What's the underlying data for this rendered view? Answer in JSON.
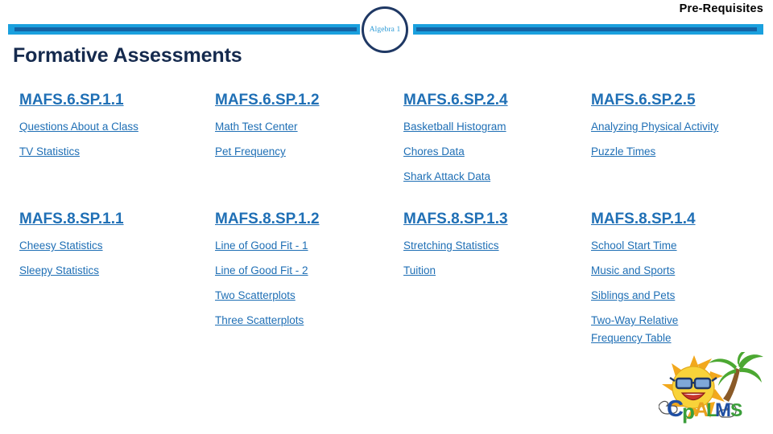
{
  "header": {
    "prerequisites_label": "Pre-Requisites",
    "node_label": "Algebra 1",
    "bar_color": "#1AA0DE",
    "bar_inner_color": "#1464A5",
    "node_border_color": "#1F3864",
    "node_text_color": "#2E9BD6"
  },
  "page": {
    "title": "Formative Assessments",
    "title_color": "#152A4E",
    "link_color": "#1F6FB5"
  },
  "rows": [
    {
      "columns": [
        {
          "standard": "MAFS.6.SP.1.1",
          "resources": [
            "Questions About a Class",
            "TV Statistics"
          ]
        },
        {
          "standard": "MAFS.6.SP.1.2",
          "resources": [
            "Math Test Center",
            "Pet Frequency"
          ]
        },
        {
          "standard": "MAFS.6.SP.2.4",
          "resources": [
            "Basketball Histogram",
            "Chores Data",
            "Shark Attack Data"
          ]
        },
        {
          "standard": "MAFS.6.SP.2.5",
          "resources": [
            "Analyzing Physical Activity",
            "Puzzle Times"
          ]
        }
      ]
    },
    {
      "columns": [
        {
          "standard": "MAFS.8.SP.1.1",
          "resources": [
            "Cheesy Statistics",
            "Sleepy Statistics"
          ]
        },
        {
          "standard": "MAFS.8.SP.1.2",
          "resources": [
            "Line of Good Fit - 1",
            "Line of Good Fit - 2",
            "Two Scatterplots",
            "Three Scatterplots"
          ]
        },
        {
          "standard": "MAFS.8.SP.1.3",
          "resources": [
            "Stretching Statistics",
            "Tuition"
          ]
        },
        {
          "standard": "MAFS.8.SP.1.4",
          "resources": [
            "School Start Time",
            "Music and Sports",
            "Siblings and Pets",
            "Two-Way Relative Frequency Table"
          ]
        }
      ]
    }
  ],
  "logo": {
    "name": "cpalms-logo",
    "text": "CPALMS",
    "letter_colors": [
      "#1F4FA3",
      "#3A9E3A",
      "#E8A020",
      "#3A9E3A",
      "#1F4FA3",
      "#3A9E3A"
    ],
    "sun_color": "#F5C518",
    "palm_color": "#4CA832"
  }
}
